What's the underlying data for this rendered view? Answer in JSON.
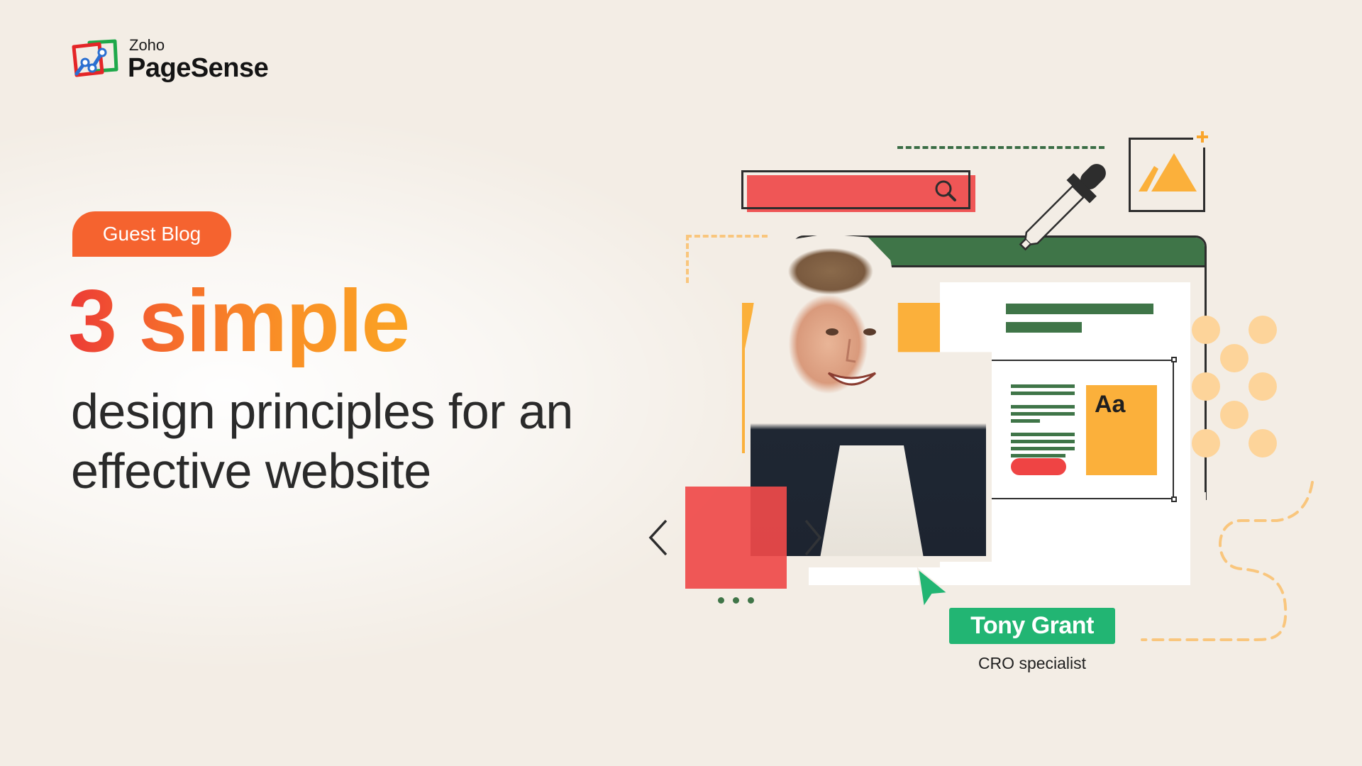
{
  "brand": {
    "company": "Zoho",
    "product": "PageSense"
  },
  "tag": {
    "label": "Guest Blog",
    "color": "#f5632f"
  },
  "headline": {
    "emphasis": "3 simple",
    "line1": "design principles for an",
    "line2": "effective website"
  },
  "author": {
    "name": "Tony Grant",
    "role": "CRO specialist",
    "badge_color": "#22b573"
  },
  "illustration": {
    "type_sample": "Aa",
    "icons": [
      "search-icon",
      "eyedropper-icon",
      "image-icon",
      "plus-icon",
      "chevron-left-icon",
      "chevron-right-icon",
      "cursor-icon"
    ],
    "carousel_dots": 3
  },
  "colors": {
    "background": "#f3ede5",
    "green": "#3f7548",
    "yellow": "#fbb03b",
    "red": "#ef5656",
    "headline_gradient": [
      "#ec3a36",
      "#fba324"
    ],
    "text_dark": "#2a2a2a"
  }
}
